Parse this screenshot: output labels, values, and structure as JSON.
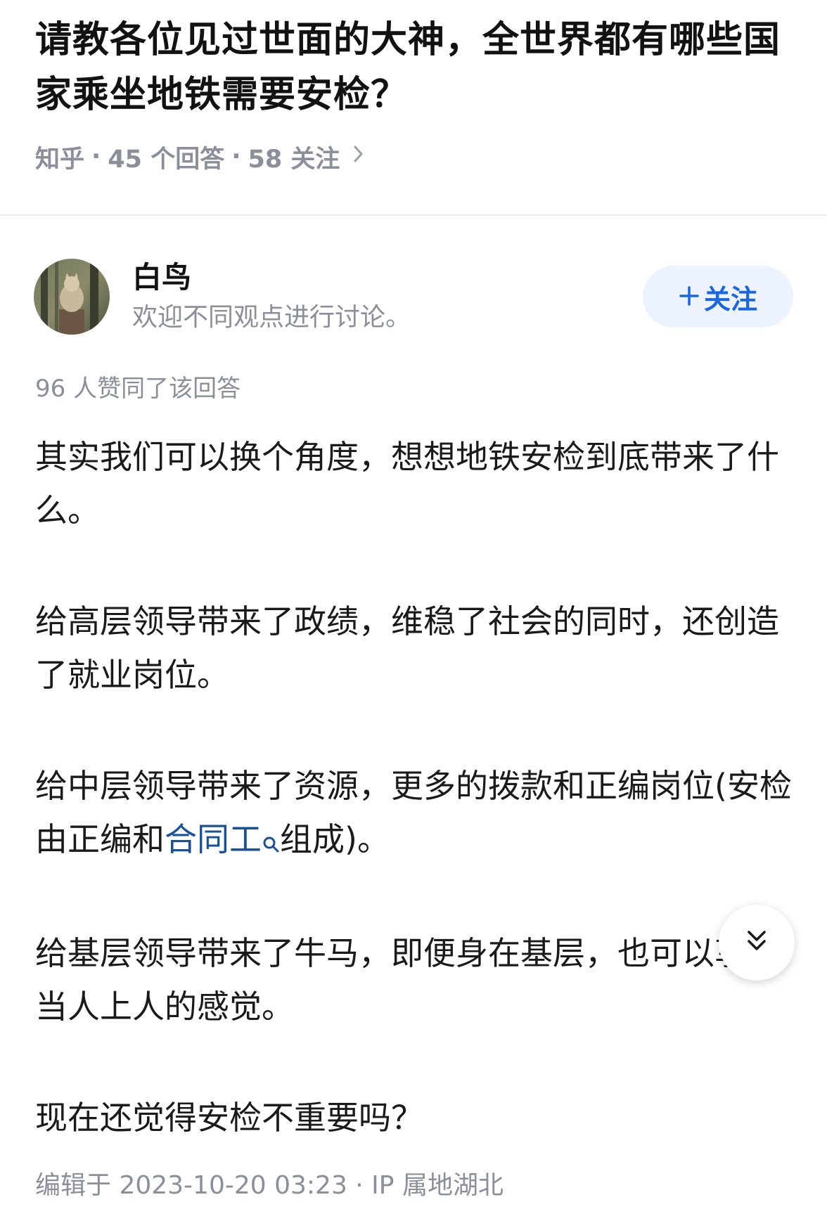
{
  "question": {
    "title": "请教各位见过世面的大神，全世界都有哪些国家乘坐地铁需要安检？",
    "source": "知乎",
    "answers_count": "45 个回答",
    "followers_count": "58 关注"
  },
  "author": {
    "name": "白鸟",
    "bio": "欢迎不同观点进行讨论。",
    "follow_label": "关注"
  },
  "answer": {
    "votes": "96 人赞同了该回答",
    "p1": "其实我们可以换个角度，想想地铁安检到底带来了什么。",
    "p2": "给高层领导带来了政绩，维稳了社会的同时，还创造了就业岗位。",
    "p3_before": "给中层领导带来了资源，更多的拨款和正编岗位(安检由正编和",
    "p3_link": "合同工",
    "p3_after": "组成)。",
    "p4": "给基层领导带来了牛马，即便身在基层，也可以享受当人上人的感觉。",
    "p5": "现在还觉得安检不重要吗？",
    "edited": "编辑于 2023-10-20 03:23 · IP 属地湖北"
  },
  "icons": {
    "follow": "plus-icon",
    "meta_arrow": "chevron-right-icon",
    "link_search": "search-icon",
    "fab": "double-chevron-down-icon"
  },
  "colors": {
    "accent": "#1a66e0",
    "link": "#175199",
    "muted": "#8a8f99",
    "follow_bg": "#edf3fe"
  }
}
